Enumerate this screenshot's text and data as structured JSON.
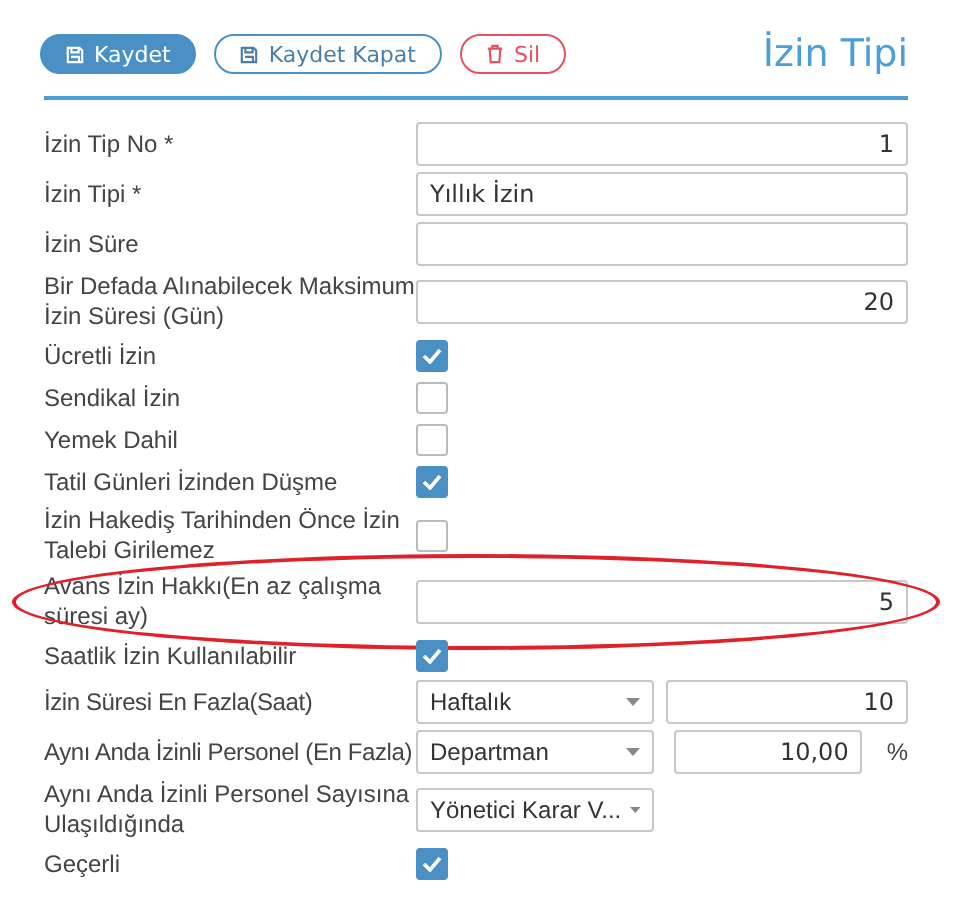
{
  "toolbar": {
    "buttons": [
      {
        "label": "Kaydet",
        "kind": "primary"
      },
      {
        "label": "Kaydet Kapat",
        "kind": "outline"
      },
      {
        "label": "Sil",
        "kind": "danger"
      }
    ]
  },
  "title": "İzin Tipi",
  "fields": [
    {
      "kind": "number",
      "label": "İzin Tip No *",
      "value": "1",
      "highlighted": false
    },
    {
      "kind": "text",
      "label": "İzin Tipi *",
      "value": "Yıllık İzin",
      "highlighted": false
    },
    {
      "kind": "text",
      "label": "İzin Süre",
      "highlighted": false
    },
    {
      "kind": "number",
      "label": "Bir Defada Alınabilecek Maksimum İzin Süresi (Gün)",
      "value": "20",
      "highlighted": false
    },
    {
      "kind": "checkbox",
      "label": "Ücretli İzin",
      "checked": true,
      "highlighted": false
    },
    {
      "kind": "checkbox",
      "label": "Sendikal İzin",
      "checked": false,
      "highlighted": false
    },
    {
      "kind": "checkbox",
      "label": "Yemek Dahil",
      "checked": false,
      "highlighted": false
    },
    {
      "kind": "checkbox",
      "label": "Tatil Günleri İzinden Düşme",
      "checked": true,
      "highlighted": false
    },
    {
      "kind": "checkbox",
      "label": "İzin Hakediş Tarihinden Önce İzin Talebi Girilemez",
      "checked": false,
      "highlighted": false
    },
    {
      "kind": "number",
      "label": "Avans İzin Hakkı(En az çalışma süresi ay)",
      "value": "5",
      "highlighted": true
    },
    {
      "kind": "checkbox",
      "label": "Saatlik İzin Kullanılabilir",
      "checked": true,
      "highlighted": false
    },
    {
      "kind": "select_number",
      "label": "İzin Süresi En Fazla(Saat)",
      "select": "Haftalık",
      "value": "10",
      "highlighted": false
    },
    {
      "kind": "select_number",
      "label": "Aynı Anda İzinli Personel (En Fazla)",
      "select": "Departman",
      "value": "10,00",
      "suffix": "%",
      "highlighted": false
    },
    {
      "kind": "select",
      "label": "Aynı Anda İzinli Personel Sayısına Ulaşıldığında",
      "select": "Yönetici Karar V...",
      "highlighted": false
    },
    {
      "kind": "checkbox",
      "label": "Geçerli",
      "checked": true,
      "highlighted": false
    }
  ]
}
